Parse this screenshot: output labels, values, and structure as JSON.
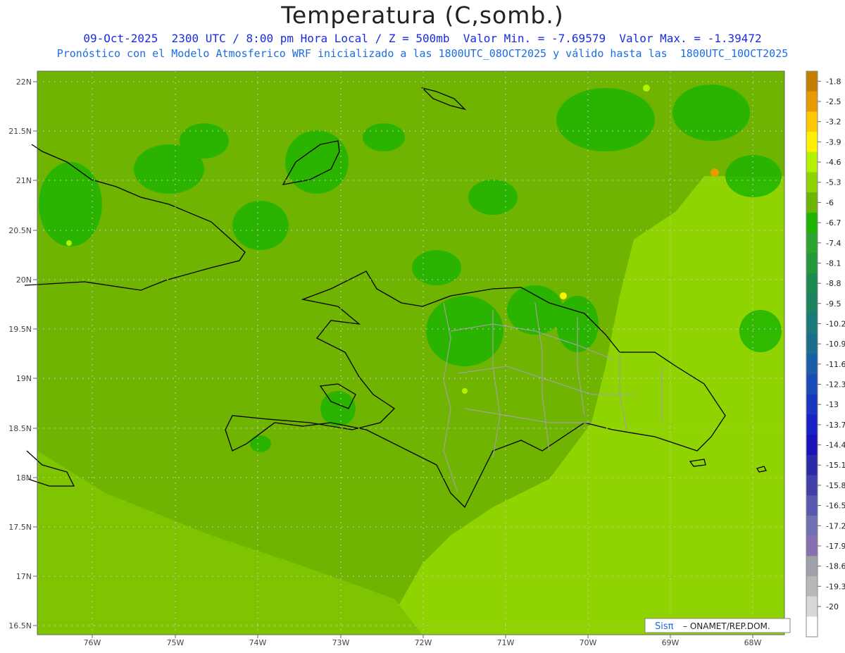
{
  "header": {
    "title": "Temperatura (C,somb.)",
    "line1": "09-Oct-2025  2300 UTC / 8:00 pm Hora Local / Z = 500mb  Valor Min. = -7.69579  Valor Max. = -1.39472",
    "line2": "Pronóstico con el Modelo Atmosferico WRF inicializado a las 1800UTC_08OCT2025 y válido hasta las  1800UTC_10OCT2025"
  },
  "axes": {
    "lat_labels": [
      "22N",
      "21.5N",
      "21N",
      "20.5N",
      "20N",
      "19.5N",
      "19N",
      "18.5N",
      "18N",
      "17.5N",
      "17N",
      "16.5N"
    ],
    "lon_labels": [
      "76W",
      "75W",
      "74W",
      "73W",
      "72W",
      "71W",
      "70W",
      "69W",
      "68W"
    ]
  },
  "colorbar": {
    "labels": [
      "-1.8",
      "-2.5",
      "-3.2",
      "-3.9",
      "-4.6",
      "-5.3",
      "-6",
      "-6.7",
      "-7.4",
      "-8.1",
      "-8.8",
      "-9.5",
      "-10.2",
      "-10.9",
      "-11.6",
      "-12.3",
      "-13",
      "-13.7",
      "-14.4",
      "-15.1",
      "-15.8",
      "-16.5",
      "-17.2",
      "-17.9",
      "-18.6",
      "-19.3",
      "-20"
    ],
    "colors": [
      "#c47f00",
      "#e89a00",
      "#ffc800",
      "#fff200",
      "#b4f000",
      "#8fd400",
      "#6fb400",
      "#1fb400",
      "#2aa530",
      "#229a3c",
      "#1a8c52",
      "#1d8260",
      "#1a7a78",
      "#1a6e8c",
      "#1a5ea8",
      "#1a4cb8",
      "#1a36c0",
      "#1a20c8",
      "#1a14b8",
      "#2a2aa8",
      "#4040a8",
      "#5858b0",
      "#7070b4",
      "#8870b0",
      "#a0a0a8",
      "#b8b8b8",
      "#d8d8d8",
      "#ffffff"
    ]
  },
  "credit": {
    "brand": "Sisπ",
    "text": "– ONAMET/REP.DOM."
  }
}
